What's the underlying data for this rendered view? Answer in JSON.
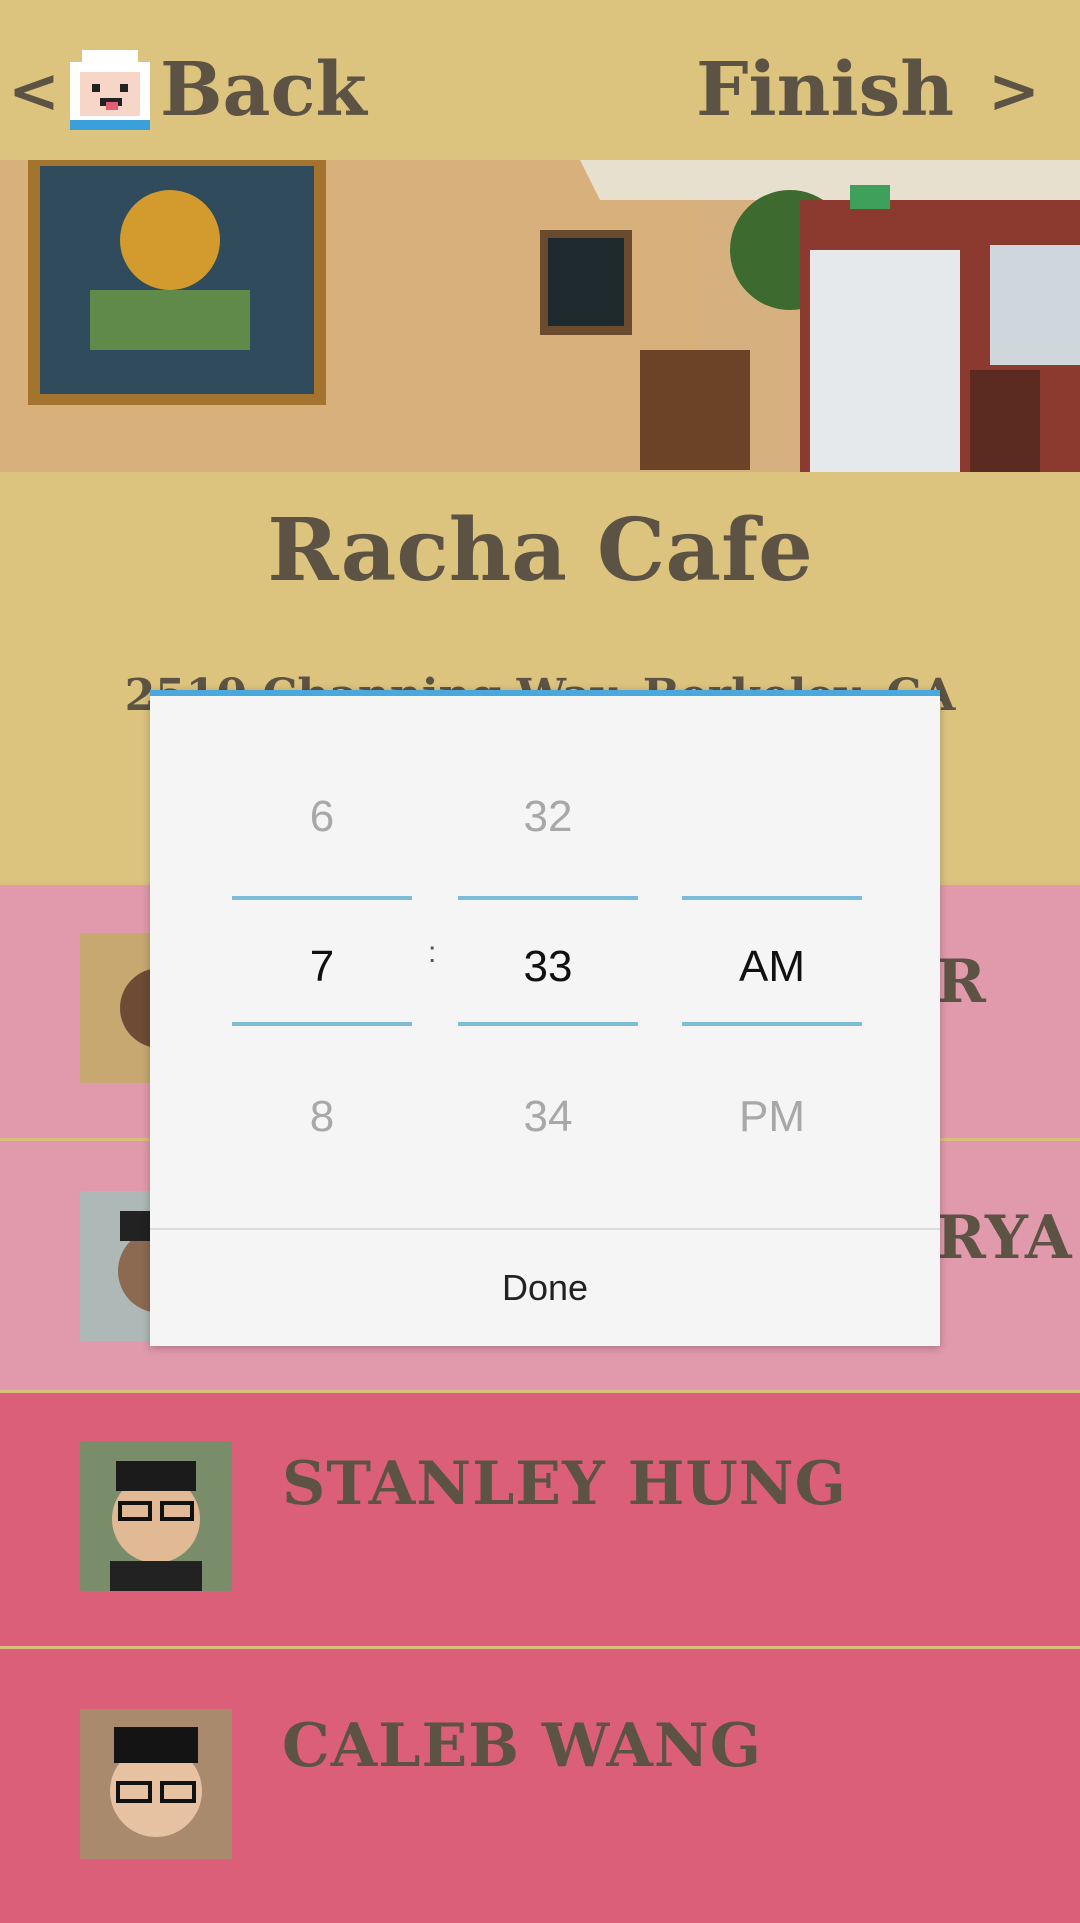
{
  "header": {
    "back_chevron": "<",
    "back_label": "Back",
    "finish_label": "Finish",
    "finish_chevron": ">"
  },
  "venue": {
    "name": "Racha Cafe",
    "address": "2510 Channing Way, Berkeley, CA"
  },
  "people": [
    {
      "name": "",
      "visible_fragment": "R"
    },
    {
      "name": "",
      "visible_fragment": "RYA"
    },
    {
      "name": "Stanley Hung"
    },
    {
      "name": "Caleb Wang"
    }
  ],
  "time_picker": {
    "hour": {
      "prev": "6",
      "selected": "7",
      "next": "8"
    },
    "separator": ":",
    "minute": {
      "prev": "32",
      "selected": "33",
      "next": "34"
    },
    "period": {
      "prev": "",
      "selected": "AM",
      "next": "PM"
    },
    "done_label": "Done",
    "accent_color": "#4aa8dc"
  },
  "colors": {
    "header_bg": "#dcc37e",
    "row_light": "#e19aab",
    "row_dark": "#dc5f79",
    "text": "#5c5344"
  }
}
